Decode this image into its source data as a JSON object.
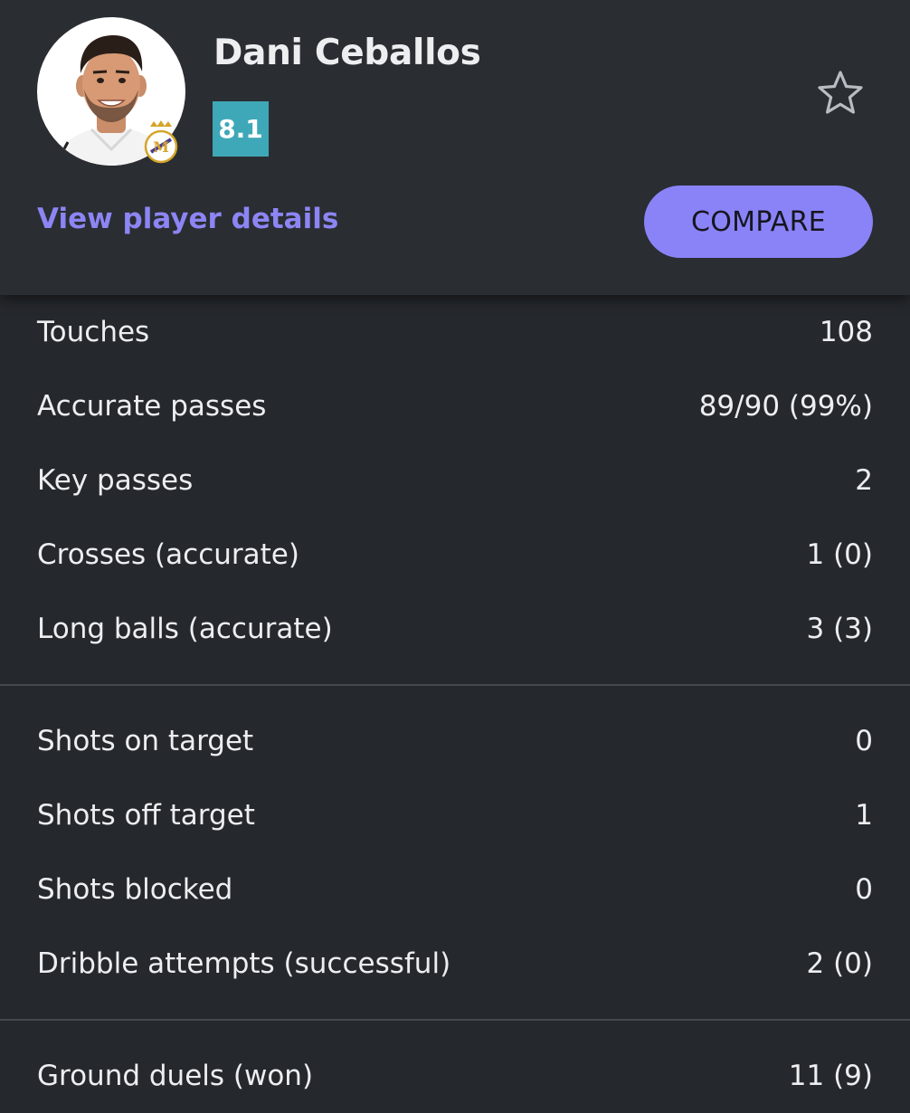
{
  "player": {
    "name": "Dani Ceballos",
    "rating": "8.1",
    "avatar_icon": "player-photo",
    "club_icon": "real-madrid-crest",
    "favorite_icon": "star-outline-icon"
  },
  "actions": {
    "view_details": "View player details",
    "compare": "COMPARE"
  },
  "colors": {
    "rating_bg": "#3fa8b8",
    "accent": "#8a83f8",
    "link": "#8c85f3",
    "background": "#25282d"
  },
  "stats": {
    "group1": [
      {
        "label": "Touches",
        "value": "108"
      },
      {
        "label": "Accurate passes",
        "value": "89/90 (99%)"
      },
      {
        "label": "Key passes",
        "value": "2"
      },
      {
        "label": "Crosses (accurate)",
        "value": "1 (0)"
      },
      {
        "label": "Long balls (accurate)",
        "value": "3 (3)"
      }
    ],
    "group2": [
      {
        "label": "Shots on target",
        "value": "0"
      },
      {
        "label": "Shots off target",
        "value": "1"
      },
      {
        "label": "Shots blocked",
        "value": "0"
      },
      {
        "label": "Dribble attempts (successful)",
        "value": "2 (0)"
      }
    ],
    "group3": [
      {
        "label": "Ground duels (won)",
        "value": "11 (9)"
      }
    ]
  }
}
